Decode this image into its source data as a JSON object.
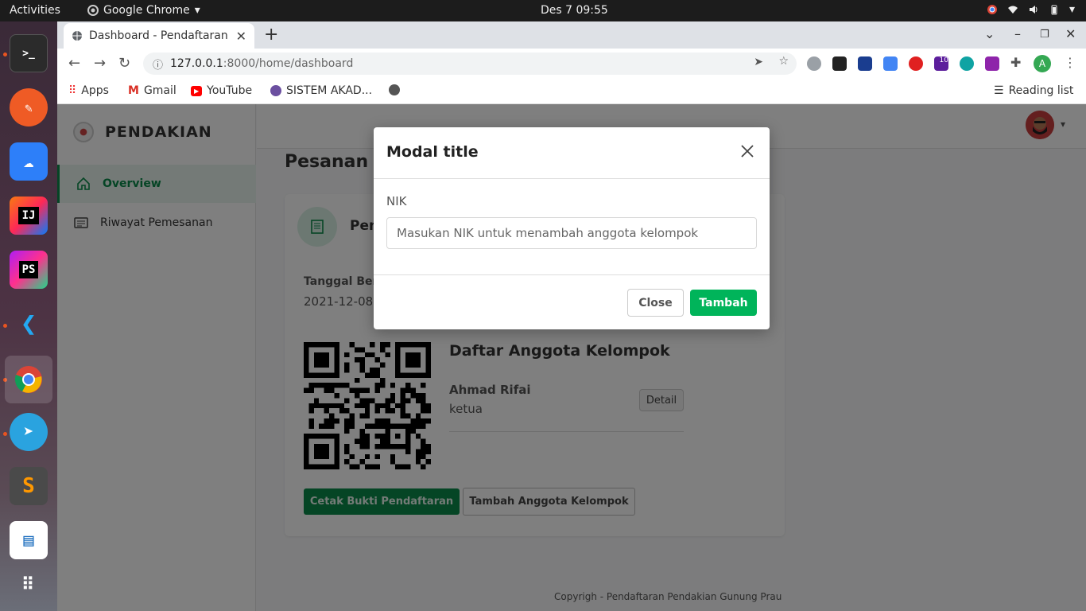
{
  "topbar": {
    "activities": "Activities",
    "app_name": "Google Chrome",
    "clock": "Des 7  09:55"
  },
  "dock": {
    "items": [
      "terminal-icon",
      "postman-icon",
      "cloud-icon",
      "intellij-icon",
      "phpstorm-icon",
      "vscode-icon",
      "chrome-icon",
      "telegram-icon",
      "sublime-icon",
      "libreoffice-writer-icon",
      "apps-grid-icon"
    ]
  },
  "browser": {
    "tab_title": "Dashboard - Pendaftaran",
    "url_host": "127.0.0.1",
    "url_path": ":8000/home/dashboard",
    "bookmarks": [
      "Apps",
      "Gmail",
      "YouTube",
      "SISTEM AKAD..."
    ],
    "reading_list": "Reading list",
    "profile_initial": "A",
    "ext_badge": "10"
  },
  "sidebar": {
    "brand": "PENDAKIAN",
    "items": [
      {
        "label": "Overview"
      },
      {
        "label": "Riwayat Pemesanan"
      }
    ]
  },
  "main": {
    "page_title": "Pesanan T",
    "card_header": "Pem",
    "date_label": "Tanggal Ber",
    "date_value": "2021-12-08",
    "group_title": "Daftar Anggota Kelompok",
    "member_name": "Ahmad Rifai",
    "member_role": "ketua",
    "detail_button": "Detail",
    "print_button": "Cetak Bukti Pendaftaran",
    "add_member_button": "Tambah Anggota Kelompok",
    "footer": "Copyrigh - Pendaftaran Pendakian Gunung Prau"
  },
  "modal": {
    "title": "Modal title",
    "field_label": "NIK",
    "field_placeholder": "Masukan NIK untuk menambah anggota kelompok",
    "field_value": "",
    "close_button": "Close",
    "submit_button": "Tambah"
  },
  "colors": {
    "accent": "#0b8a4a",
    "submit": "#00b45a"
  }
}
